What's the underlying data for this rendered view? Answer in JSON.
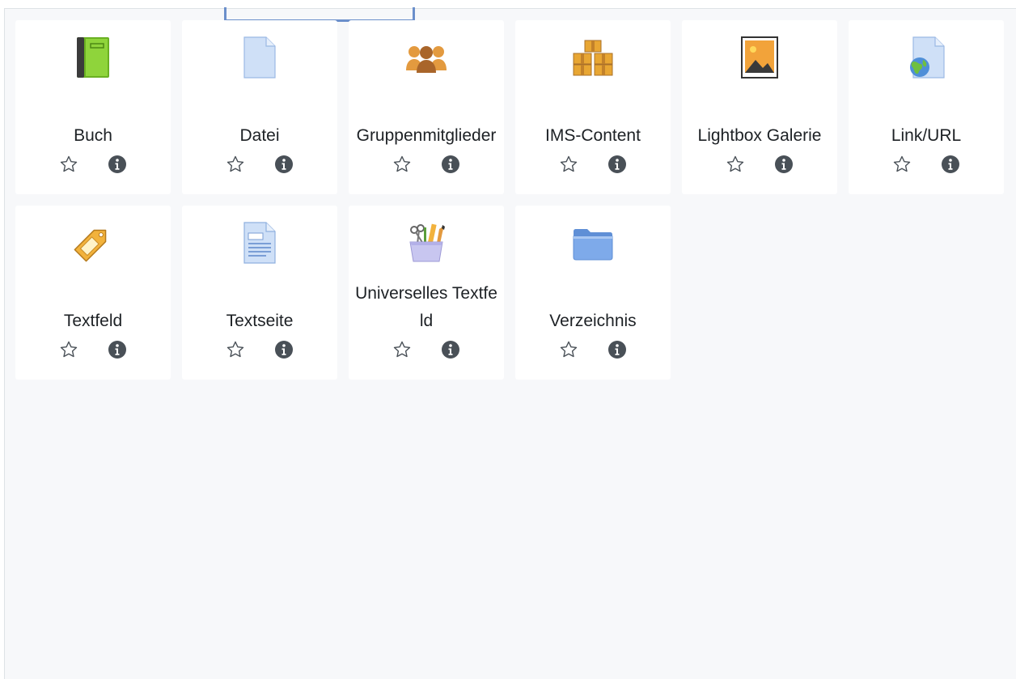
{
  "modules": [
    {
      "label": "Buch",
      "icon": "book-icon"
    },
    {
      "label": "Datei",
      "icon": "file-icon"
    },
    {
      "label": "Gruppenmitglieder",
      "icon": "group-members-icon"
    },
    {
      "label": "IMS-Content",
      "icon": "ims-content-icon"
    },
    {
      "label": "Lightbox Galerie",
      "icon": "lightbox-gallery-icon"
    },
    {
      "label": "Link/URL",
      "icon": "link-url-icon"
    },
    {
      "label": "Textfeld",
      "icon": "label-tag-icon"
    },
    {
      "label": "Textseite",
      "icon": "text-page-icon"
    },
    {
      "label": "Universelles Textfeld",
      "icon": "universal-textfield-icon"
    },
    {
      "label": "Verzeichnis",
      "icon": "folder-icon"
    }
  ],
  "actions": {
    "star_icon": "star-outline-icon",
    "info_icon": "info-circle-icon"
  },
  "colors": {
    "panel_bg": "#f7f8fa",
    "card_bg": "#ffffff",
    "focus_outline": "#6b8fcb",
    "text": "#1d2125",
    "action_icon": "#495057"
  }
}
